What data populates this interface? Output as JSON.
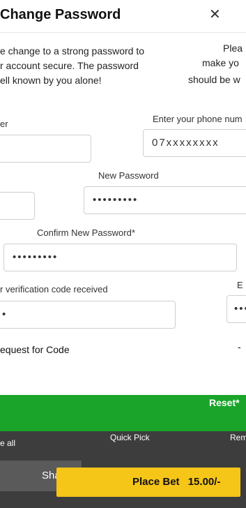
{
  "modal": {
    "title": "Change Password",
    "close_glyph": "✕",
    "description": {
      "left": [
        "e change to a strong password to",
        "r account secure. The password",
        "ell known by you alone!"
      ],
      "right": [
        "Plea",
        "make yo",
        "should be w"
      ]
    },
    "phone_label_left": "er",
    "phone_label_right": "Enter your phone num",
    "phone_value": "07xxxxxxxx",
    "new_password_label": "New Password",
    "new_password_value": "•••••••••",
    "confirm_password_label": "Confirm New Password*",
    "confirm_password_value": "•••••••••",
    "verification_label": "r verification code received",
    "verification_value": "•",
    "right_partial_label": "E",
    "right_partial_value": "•••",
    "request_code_link": "equest for Code",
    "request_code_right": "-"
  },
  "footer": {
    "reset_label": "Reset*",
    "tabs": {
      "left": "e all",
      "middle": "Quick Pick",
      "right": "Rem"
    },
    "share_label": "Share",
    "place_bet_label": "Place Bet",
    "place_bet_amount": "15.00/-"
  },
  "colors": {
    "accent_green": "#1aa52a",
    "bet_yellow": "#f5c518",
    "footer_dark": "#3d3d3d"
  },
  "icons": {
    "close": "close-icon"
  }
}
